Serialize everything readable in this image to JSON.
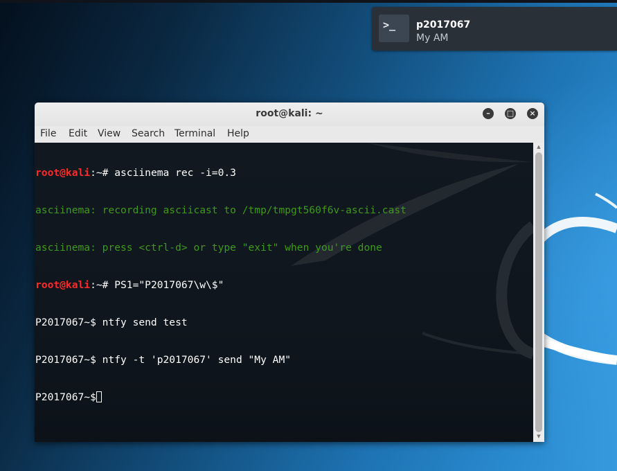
{
  "notification": {
    "icon": "terminal-icon",
    "icon_glyph": ">_",
    "title": "p2017067",
    "body": "My AM"
  },
  "window": {
    "title": "root@kali: ~",
    "buttons": {
      "minimize": "minimize-icon",
      "maximize": "maximize-icon",
      "close": "close-icon"
    },
    "menu": [
      "File",
      "Edit",
      "View",
      "Search",
      "Terminal",
      "Help"
    ]
  },
  "terminal": {
    "lines": [
      {
        "user": "root@kali",
        "rest": ":~# asciinema rec -i=0.3"
      },
      {
        "text": "asciinema: recording asciicast to /tmp/tmpgt560f6v-ascii.cast"
      },
      {
        "text": "asciinema: press <ctrl-d> or type \"exit\" when you're done"
      },
      {
        "user": "root@kali",
        "rest": ":~# PS1=\"P2017067\\w\\$\""
      },
      {
        "text": "P2017067~$ ntfy send test"
      },
      {
        "text": "P2017067~$ ntfy -t 'p2017067' send \"My AM\""
      },
      {
        "text": "P2017067~$"
      }
    ]
  },
  "colors": {
    "prompt_user": "#ff2a2a",
    "info_text": "#3e9a1c",
    "terminal_bg": "#111820",
    "notification_bg": "#2a3038"
  }
}
